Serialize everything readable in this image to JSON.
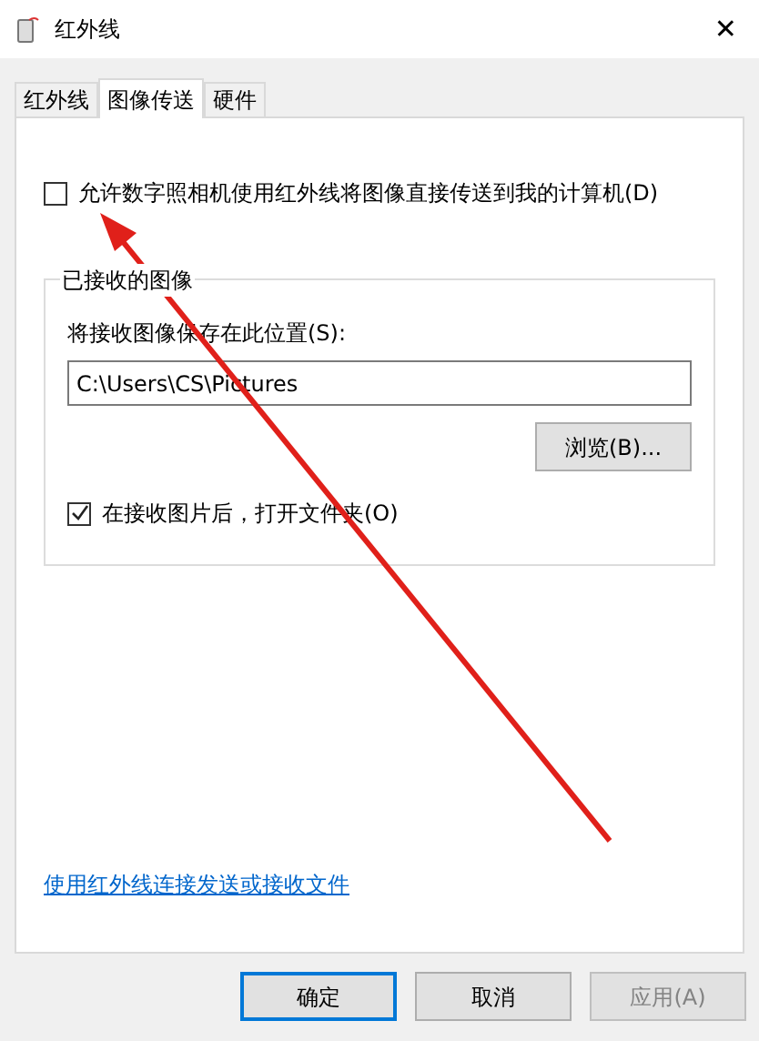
{
  "window": {
    "title": "红外线",
    "close": "✕"
  },
  "tabs": [
    {
      "label": "红外线",
      "selected": false
    },
    {
      "label": "图像传送",
      "selected": true
    },
    {
      "label": "硬件",
      "selected": false
    }
  ],
  "allow_option": {
    "label": "允许数字照相机使用红外线将图像直接传送到我的计算机(D)",
    "checked": false
  },
  "received_group": {
    "title": "已接收的图像",
    "save_label": "将接收图像保存在此位置(S):",
    "save_path": "C:\\Users\\CS\\Pictures",
    "browse": "浏览(B)...",
    "open_option": {
      "label": "在接收图片后，打开文件夹(O)",
      "checked": true
    }
  },
  "link": "使用红外线连接发送或接收文件",
  "buttons": [
    {
      "label": "确定",
      "kind": "default",
      "disabled": false
    },
    {
      "label": "取消",
      "kind": "normal",
      "disabled": false
    },
    {
      "label": "应用(A)",
      "kind": "normal",
      "disabled": true
    }
  ]
}
